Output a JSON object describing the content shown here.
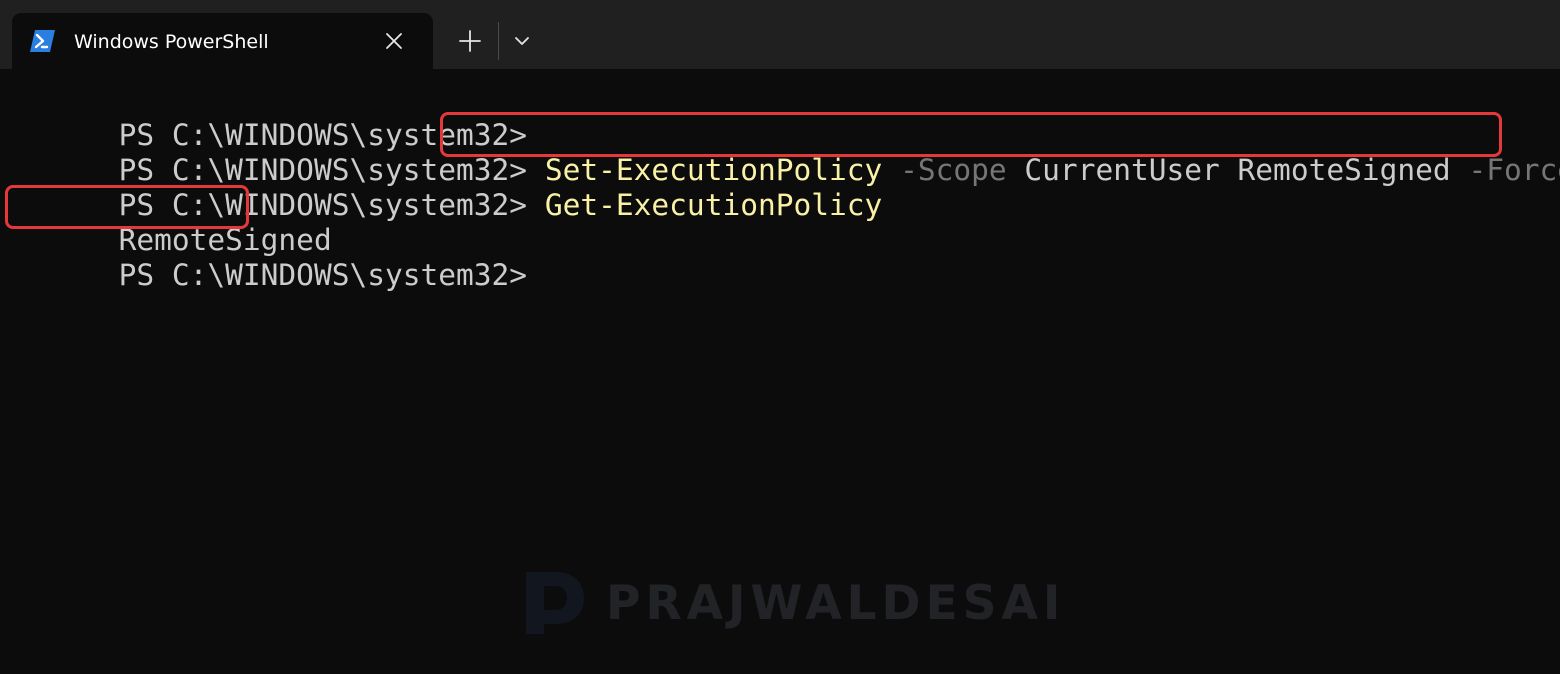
{
  "tab": {
    "title": "Windows PowerShell",
    "icon": "powershell-icon",
    "close_icon": "close-icon"
  },
  "toolbar": {
    "new_tab_icon": "plus-icon",
    "dropdown_icon": "chevron-down-icon"
  },
  "terminal": {
    "lines": [
      {
        "prompt": "PS C:\\WINDOWS\\system32>",
        "command": "",
        "param1": "",
        "args": "",
        "param2": ""
      },
      {
        "prompt": "PS C:\\WINDOWS\\system32>",
        "command": "Set-ExecutionPolicy",
        "param1": "-Scope",
        "args": "CurrentUser RemoteSigned",
        "param2": "-Force"
      },
      {
        "prompt": "PS C:\\WINDOWS\\system32>",
        "command": "Get-ExecutionPolicy",
        "param1": "",
        "args": "",
        "param2": ""
      },
      {
        "output": "RemoteSigned"
      },
      {
        "prompt": "PS C:\\WINDOWS\\system32>",
        "command": "",
        "param1": "",
        "args": "",
        "param2": ""
      }
    ]
  },
  "watermark": {
    "text": "PRAJWALDESAI",
    "logo_letter": "P"
  },
  "colors": {
    "background": "#0c0c0c",
    "tabbar": "#202020",
    "prompt_text": "#cccccc",
    "command_text": "#f9f1a5",
    "parameter_text": "#767676",
    "highlight_border": "#e5383b"
  }
}
